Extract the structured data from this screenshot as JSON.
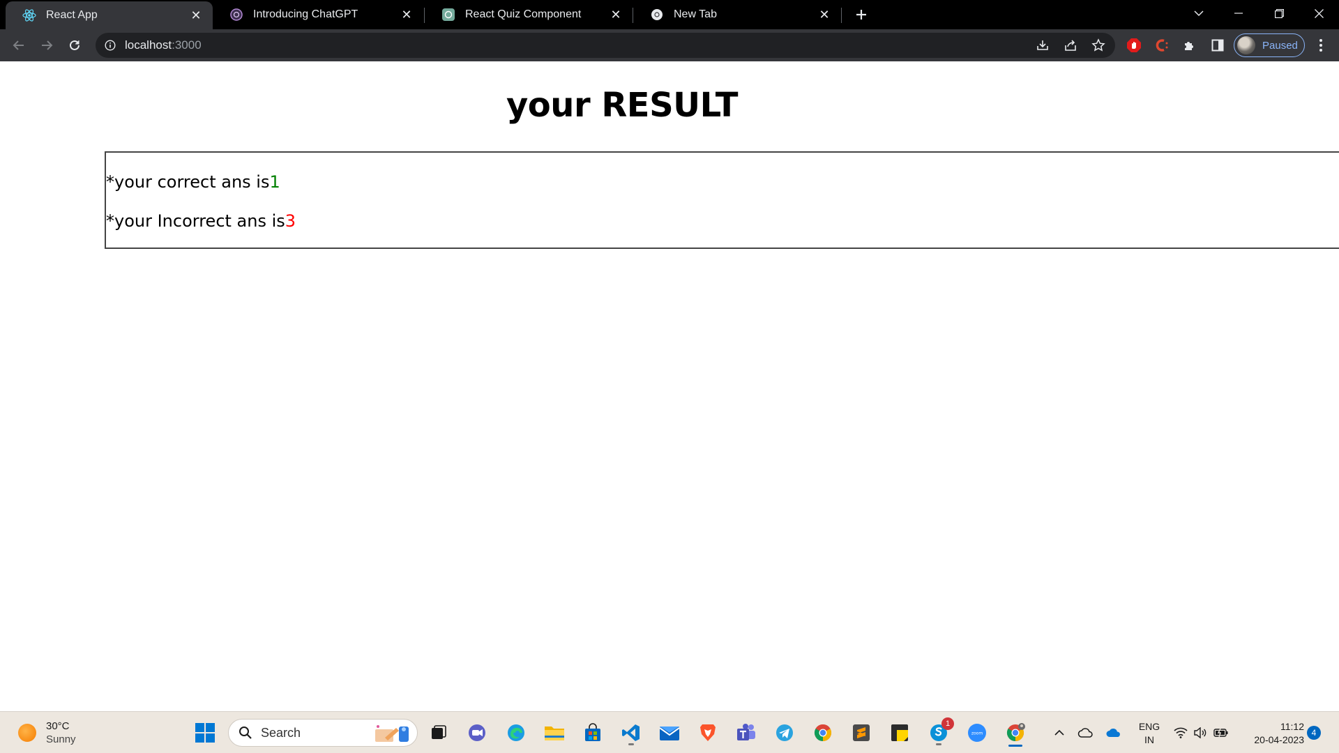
{
  "browser": {
    "tabs": [
      {
        "title": "React App",
        "favicon": "react-icon",
        "active": true
      },
      {
        "title": "Introducing ChatGPT",
        "favicon": "chatgpt-icon",
        "active": false
      },
      {
        "title": "React Quiz Component",
        "favicon": "openai-icon",
        "active": false
      },
      {
        "title": "New Tab",
        "favicon": "chrome-icon",
        "active": false
      }
    ],
    "url_host": "localhost",
    "url_port": ":3000",
    "profile_status": "Paused"
  },
  "page": {
    "title": "your RESULT",
    "correct_label": "*your correct ans is",
    "correct_value": "1",
    "incorrect_label": "*your Incorrect ans is",
    "incorrect_value": "3",
    "colors": {
      "correct": "#008000",
      "incorrect": "#ff0000"
    }
  },
  "taskbar": {
    "weather_temp": "30°C",
    "weather_condition": "Sunny",
    "search_label": "Search",
    "skype_badge": "1",
    "lang_primary": "ENG",
    "lang_secondary": "IN",
    "time": "11:12",
    "date": "20-04-2023",
    "notification_count": "4"
  }
}
